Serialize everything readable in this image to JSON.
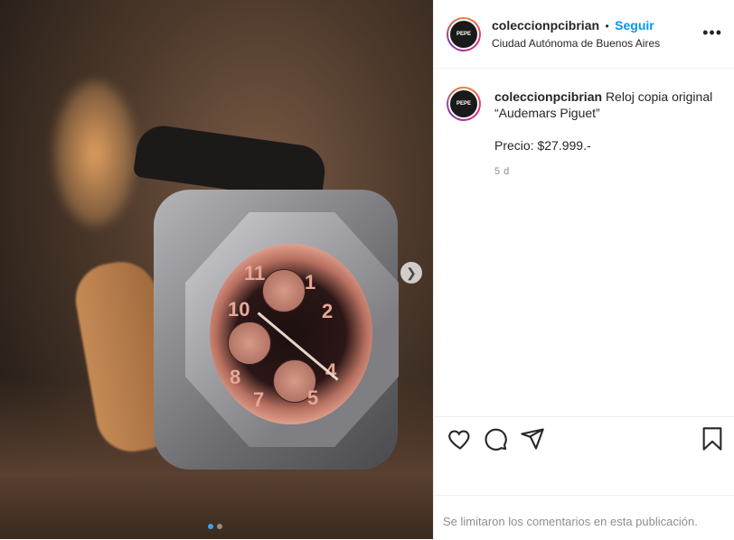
{
  "post": {
    "image_alt": "Reloj Audemars Piguet",
    "carousel": {
      "current": 1,
      "total": 2
    }
  },
  "header": {
    "username": "coleccionpcibrian",
    "separator": "•",
    "follow_label": "Seguir",
    "location": "Ciudad Autónoma de Buenos Aires",
    "more_label": "•••",
    "avatar_text": "COLECCION PEPE CIBRIAN"
  },
  "caption": {
    "username": "coleccionpcibrian",
    "text": "Reloj copia original “Audemars Piguet”",
    "price": "Precio: $27.999.-",
    "time": "5 d"
  },
  "actions": {
    "like_icon": "heart-icon",
    "comment_icon": "comment-icon",
    "share_icon": "share-icon",
    "save_icon": "bookmark-icon"
  },
  "footer": {
    "comments_disabled": "Se limitaron los comentarios en esta publicación."
  },
  "dial": {
    "numerals": [
      "11",
      "10",
      "8",
      "7",
      "5",
      "4",
      "2",
      "1"
    ]
  }
}
